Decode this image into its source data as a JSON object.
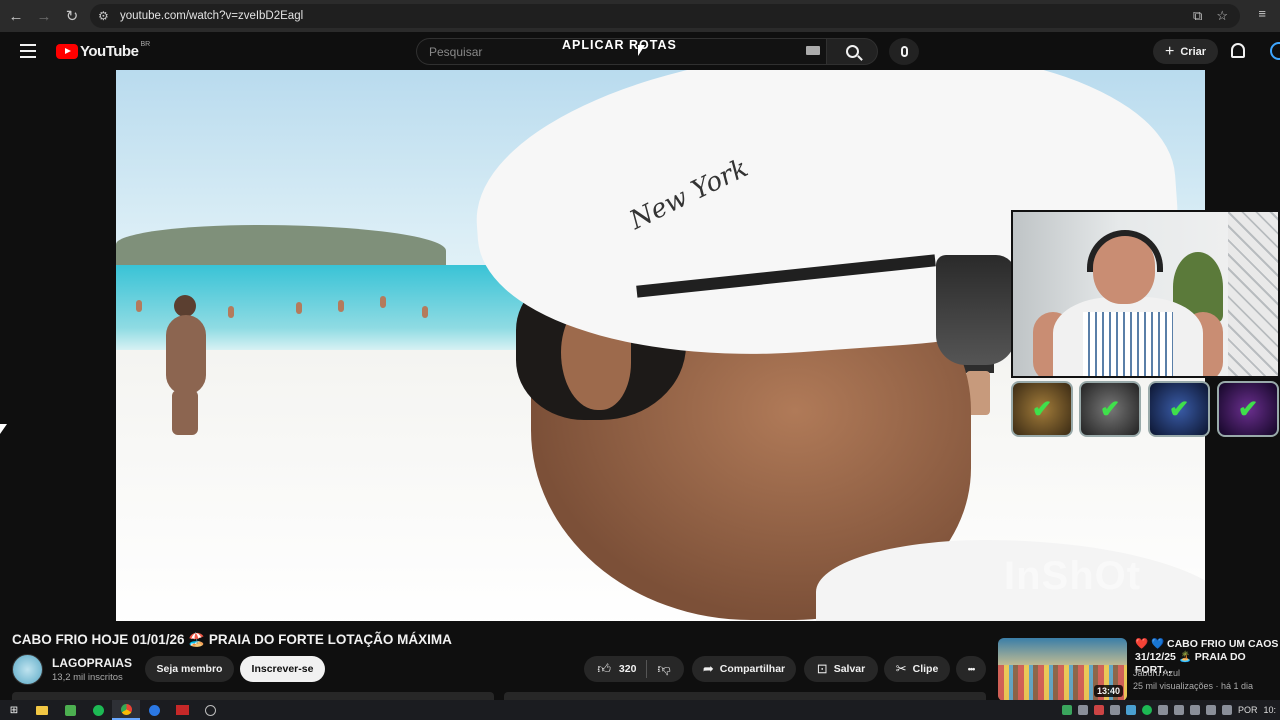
{
  "browser": {
    "url": "youtube.com/watch?v=zveIbD2Eagl"
  },
  "header": {
    "logo_text": "YouTube",
    "country": "BR",
    "search_placeholder": "Pesquisar",
    "overlay_caption": "APLICAR ROTAS",
    "create_label": "Criar"
  },
  "player": {
    "watermark": "InShOt",
    "cap_text": "New York"
  },
  "badges": [
    {
      "icon": "check-icon",
      "glyph": "✔",
      "color": "#3fe04b"
    },
    {
      "icon": "check-icon",
      "glyph": "✔",
      "color": "#3fe04b"
    },
    {
      "icon": "check-icon",
      "glyph": "✔",
      "color": "#3fe04b"
    },
    {
      "icon": "check-icon",
      "glyph": "✔",
      "color": "#3fe04b"
    }
  ],
  "video": {
    "title": "CABO FRIO HOJE 01/01/26 🏖️ PRAIA DO FORTE LOTAÇÃO MÁXIMA",
    "channel_name": "LAGOPRAIAS",
    "subscribers": "13,2 mil inscritos",
    "member_label": "Seja membro",
    "subscribe_label": "Inscrever-se",
    "likes": "320",
    "share_label": "Compartilhar",
    "save_label": "Salvar",
    "clip_label": "Clipe",
    "more_glyph": "•••"
  },
  "recommendation": {
    "title": "❤️ 💙 CABO FRIO UM CAOS 31/12/25 🏝️ PRAIA DO FORT...",
    "channel": "Jaburu Azul",
    "meta": "25 mil visualizações · há 1 dia",
    "duration": "13:40"
  },
  "taskbar": {
    "language": "POR",
    "clock": "10:"
  },
  "colors": {
    "accent_red": "#ff0000",
    "check_green": "#3fe04b",
    "background": "#0f0f0f"
  }
}
